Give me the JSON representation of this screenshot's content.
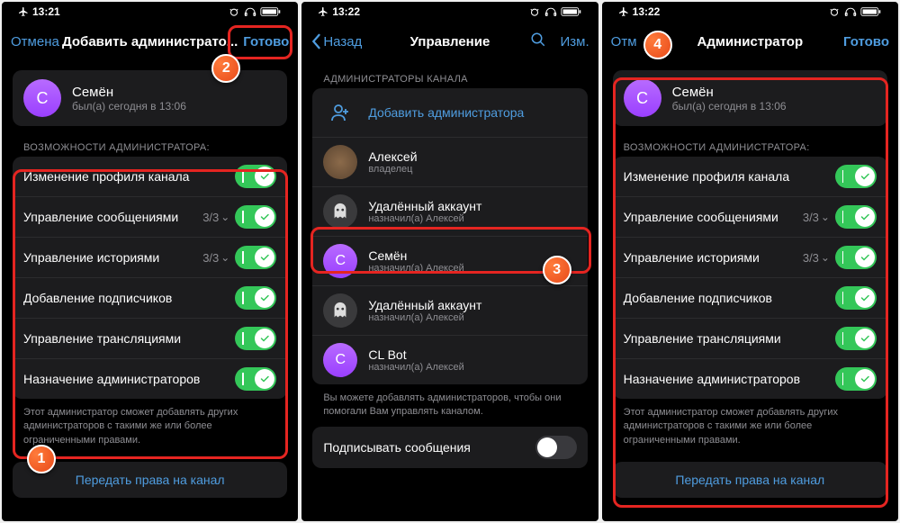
{
  "colors": {
    "accent": "#4F9DE0",
    "toggle_on": "#34c759",
    "callout": "#e84a1a",
    "highlight": "#e52521"
  },
  "status": {
    "time1": "13:21",
    "time2": "13:22",
    "time3": "13:22"
  },
  "panel1": {
    "nav_cancel": "Отмена",
    "nav_title": "Добавить администрато...",
    "nav_done": "Готово",
    "user": {
      "initial": "С",
      "name": "Семён",
      "status": "был(а) сегодня в 13:06"
    },
    "section": "ВОЗМОЖНОСТИ АДМИНИСТРАТОРА:",
    "perms": [
      {
        "label": "Изменение профиля канала"
      },
      {
        "label": "Управление сообщениями",
        "count": "3/3",
        "expand": true
      },
      {
        "label": "Управление историями",
        "count": "3/3",
        "expand": true
      },
      {
        "label": "Добавление подписчиков"
      },
      {
        "label": "Управление трансляциями"
      },
      {
        "label": "Назначение администраторов"
      }
    ],
    "note": "Этот администратор сможет добавлять других администраторов с такими же или более ограниченными правами.",
    "transfer": "Передать права на канал"
  },
  "panel2": {
    "nav_back": "Назад",
    "nav_title": "Управление",
    "nav_edit": "Изм.",
    "section": "АДМИНИСТРАТОРЫ КАНАЛА",
    "add": "Добавить администратора",
    "admins": [
      {
        "name": "Алексей",
        "sub": "владелец",
        "avatar": "brown",
        "initial": ""
      },
      {
        "name": "Удалённый аккаунт",
        "sub": "назначил(а) Алексей",
        "avatar": "ghost",
        "initial": ""
      },
      {
        "name": "Семён",
        "sub": "назначил(а) Алексей",
        "avatar": "purple",
        "initial": "С"
      },
      {
        "name": "Удалённый аккаунт",
        "sub": "назначил(а) Алексей",
        "avatar": "ghost",
        "initial": ""
      },
      {
        "name": "CL Bot",
        "sub": "назначил(а) Алексей",
        "avatar": "purple",
        "initial": "C"
      }
    ],
    "note": "Вы можете добавлять администраторов, чтобы они помогали Вам управлять каналом.",
    "sign": "Подписывать сообщения"
  },
  "panel3": {
    "nav_cancel": "Отм",
    "nav_title": "Администратор",
    "nav_done": "Готово",
    "user": {
      "initial": "С",
      "name": "Семён",
      "status": "был(а) сегодня в 13:06"
    },
    "section": "ВОЗМОЖНОСТИ АДМИНИСТРАТОРА:",
    "perms": [
      {
        "label": "Изменение профиля канала"
      },
      {
        "label": "Управление сообщениями",
        "count": "3/3",
        "expand": true
      },
      {
        "label": "Управление историями",
        "count": "3/3",
        "expand": true
      },
      {
        "label": "Добавление подписчиков"
      },
      {
        "label": "Управление трансляциями"
      },
      {
        "label": "Назначение администраторов"
      }
    ],
    "note": "Этот администратор сможет добавлять других администраторов с такими же или более ограниченными правами.",
    "transfer": "Передать права на канал"
  },
  "callouts": {
    "c1": "1",
    "c2": "2",
    "c3": "3",
    "c4": "4"
  }
}
